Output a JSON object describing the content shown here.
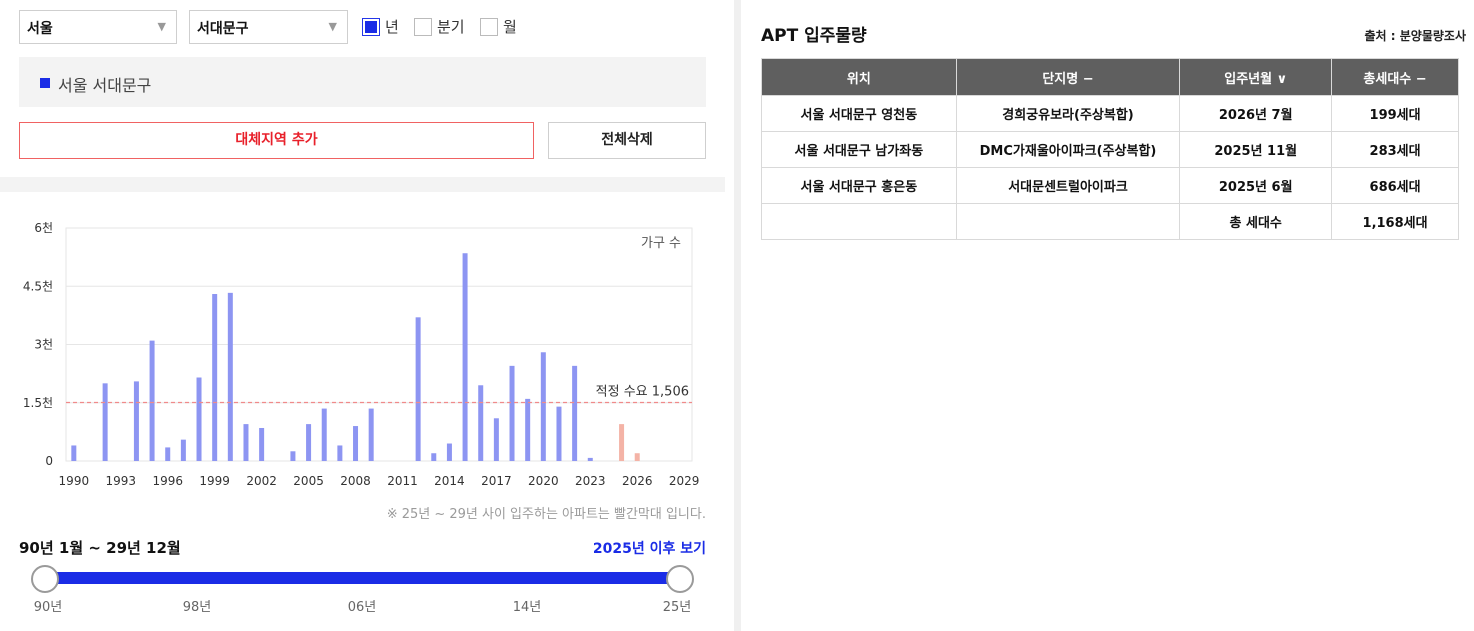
{
  "filters": {
    "city": "서울",
    "district": "서대문구",
    "period_options": [
      {
        "label": "년",
        "checked": true
      },
      {
        "label": "분기",
        "checked": false
      },
      {
        "label": "월",
        "checked": false
      }
    ]
  },
  "selected_region": "서울 서대문구",
  "buttons": {
    "add_region": "대체지역 추가",
    "delete_all": "전체삭제"
  },
  "chart_data": {
    "type": "bar",
    "legend_text": "가구 수",
    "y_ticks": [
      "0",
      "1.5천",
      "3천",
      "4.5천",
      "6천"
    ],
    "ylim": [
      0,
      6000
    ],
    "x_ticks": [
      "1990",
      "1993",
      "1996",
      "1999",
      "2002",
      "2005",
      "2008",
      "2011",
      "2014",
      "2017",
      "2020",
      "2023",
      "2026",
      "2029"
    ],
    "xlim": [
      1989.5,
      2029.5
    ],
    "threshold": {
      "label": "적정 수요 1,506",
      "value": 1506
    },
    "colors": {
      "past": "#8d95f2",
      "future": "#f4b3a6",
      "threshold": "#f08a8a"
    },
    "x": [
      1990,
      1991,
      1992,
      1993,
      1994,
      1995,
      1996,
      1997,
      1998,
      1999,
      2000,
      2001,
      2002,
      2003,
      2004,
      2005,
      2006,
      2007,
      2008,
      2009,
      2010,
      2011,
      2012,
      2013,
      2014,
      2015,
      2016,
      2017,
      2018,
      2019,
      2020,
      2021,
      2022,
      2023,
      2024,
      2025,
      2026,
      2027,
      2028,
      2029
    ],
    "values": [
      400,
      0,
      2000,
      0,
      2050,
      3100,
      350,
      550,
      2150,
      4300,
      4330,
      950,
      850,
      0,
      250,
      950,
      1350,
      400,
      900,
      1350,
      0,
      0,
      3700,
      200,
      450,
      5350,
      1950,
      1100,
      2450,
      1600,
      2800,
      1400,
      2450,
      80,
      0,
      950,
      200,
      0,
      0,
      0
    ],
    "future_from": 2025
  },
  "chart_note": "※ 25년 ~ 29년 사이 입주하는 아파트는 빨간막대 입니다.",
  "range": {
    "title": "90년 1월 ~ 29년 12월",
    "link": "2025년 이후 보기",
    "labels": [
      "90년",
      "98년",
      "06년",
      "14년",
      "25년"
    ]
  },
  "apt": {
    "title": "APT 입주물량",
    "source": "출처 : 분양물량조사",
    "headers": [
      "위치",
      "단지명 −",
      "입주년월 ∨",
      "총세대수 −"
    ],
    "rows": [
      [
        "서울 서대문구 영천동",
        "경희궁유보라(주상복합)",
        "2026년 7월",
        "199세대"
      ],
      [
        "서울 서대문구 남가좌동",
        "DMC가재울아이파크(주상복합)",
        "2025년 11월",
        "283세대"
      ],
      [
        "서울 서대문구 홍은동",
        "서대문센트럴아이파크",
        "2025년 6월",
        "686세대"
      ]
    ],
    "total_label": "총 세대수",
    "total_value": "1,168세대"
  }
}
